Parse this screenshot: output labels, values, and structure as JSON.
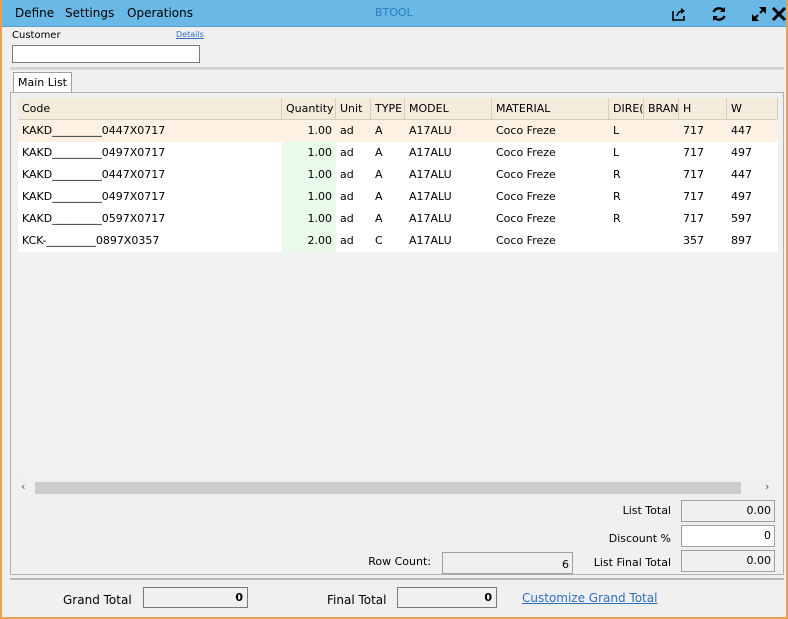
{
  "menu": {
    "define": "Define",
    "settings": "Settings",
    "operations": "Operations"
  },
  "app_title": "BTOOL",
  "toolbar_icons": [
    "share-icon",
    "refresh-icon",
    "expand-icon",
    "close-icon"
  ],
  "customer": {
    "label": "Customer",
    "details_link": "Details",
    "value": ""
  },
  "tabs": [
    {
      "label": "Main List"
    }
  ],
  "grid": {
    "columns": [
      "Code",
      "Quantity",
      "Unit",
      "TYPE",
      "MODEL",
      "MATERIAL",
      "DIRE(",
      "BRAN",
      "H",
      "W"
    ],
    "rows": [
      [
        "KAKD_________0447X0717",
        "1.00",
        "ad",
        "A",
        "A17ALU",
        "Coco Freze",
        "L",
        "",
        "717",
        "447"
      ],
      [
        "KAKD_________0497X0717",
        "1.00",
        "ad",
        "A",
        "A17ALU",
        "Coco Freze",
        "L",
        "",
        "717",
        "497"
      ],
      [
        "KAKD_________0447X0717",
        "1.00",
        "ad",
        "A",
        "A17ALU",
        "Coco Freze",
        "R",
        "",
        "717",
        "447"
      ],
      [
        "KAKD_________0497X0717",
        "1.00",
        "ad",
        "A",
        "A17ALU",
        "Coco Freze",
        "R",
        "",
        "717",
        "497"
      ],
      [
        "KAKD_________0597X0717",
        "1.00",
        "ad",
        "A",
        "A17ALU",
        "Coco Freze",
        "R",
        "",
        "717",
        "597"
      ],
      [
        "KCK-_________0897X0357",
        "2.00",
        "ad",
        "C",
        "A17ALU",
        "Coco Freze",
        "",
        "",
        "357",
        "897"
      ]
    ]
  },
  "summary": {
    "list_total_label": "List Total",
    "list_total_value": "0.00",
    "discount_label": "Discount %",
    "discount_value": "0",
    "row_count_label": "Row Count:",
    "row_count_value": "6",
    "list_final_total_label": "List Final Total",
    "list_final_total_value": "0.00"
  },
  "footer": {
    "grand_total_label": "Grand Total",
    "grand_total_value": "0",
    "final_total_label": "Final Total",
    "final_total_value": "0",
    "customize_link": "Customize Grand Total"
  },
  "colors": {
    "menubar": "#6ab8e6",
    "title": "#2f7fc0",
    "header": "#f3ebdc",
    "selected_row": "#fcf1e3",
    "quantity_cell": "#eafaea",
    "link": "#2f6fc0"
  }
}
